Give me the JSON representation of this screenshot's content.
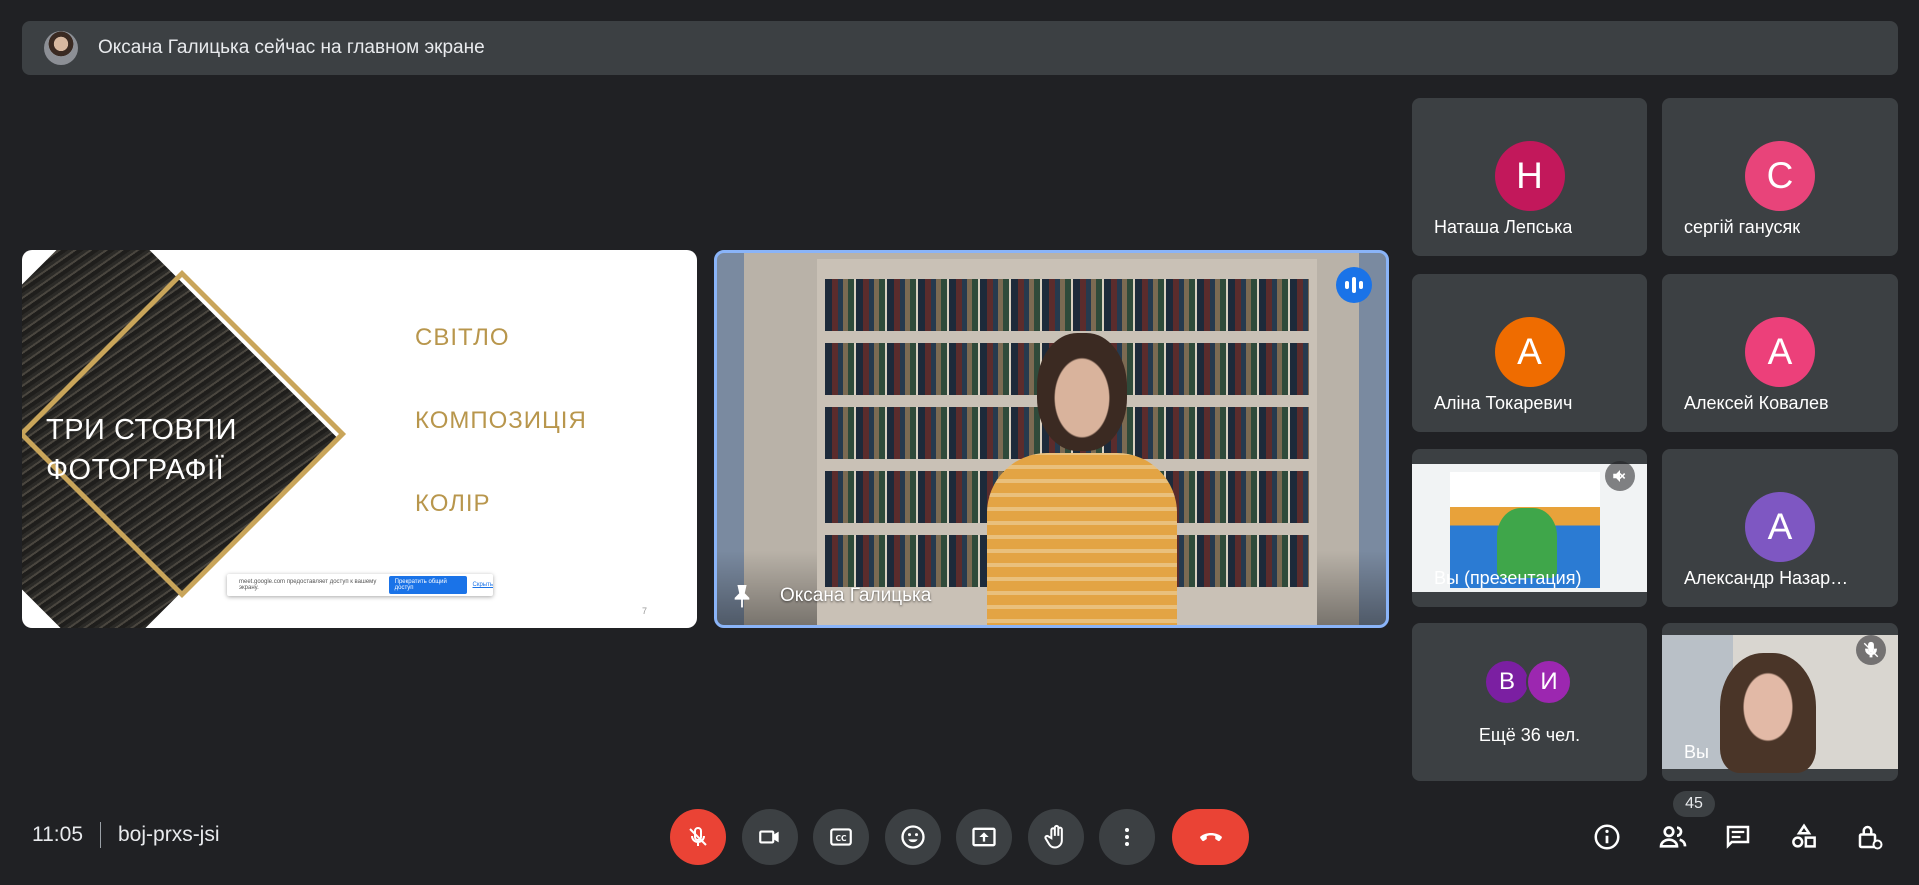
{
  "banner": {
    "text": "Оксана Галицька сейчас на главном экране"
  },
  "slide": {
    "title": "ТРИ СТОВПИ ФОТОГРАФІЇ",
    "items": [
      "СВІТЛО",
      "КОМПОЗИЦІЯ",
      "КОЛІР"
    ],
    "share_notice": "meet.google.com предоставляет доступ к вашему экрану.",
    "share_stop": "Прекратить общий доступ",
    "share_hide": "Скрыть",
    "page_number": "7"
  },
  "main_video": {
    "name": "Оксана Галицька"
  },
  "participants": [
    {
      "initial": "Н",
      "name": "Наташа Лепська",
      "color": "#c2185b"
    },
    {
      "initial": "С",
      "name": "сергій ганусяк",
      "color": "#e8447a"
    },
    {
      "initial": "А",
      "name": "Аліна Токаревич",
      "color": "#ef6c00"
    },
    {
      "initial": "А",
      "name": "Алексей Ковалев",
      "color": "#ec407a"
    },
    {
      "initial": "",
      "name": "Вы (презентация)",
      "color": ""
    },
    {
      "initial": "А",
      "name": "Александр Назар…",
      "color": "#7e57c2"
    }
  ],
  "more": {
    "initials": [
      "В",
      "И"
    ],
    "colors": [
      "#7b1fa2",
      "#9c27b0"
    ],
    "text": "Ещё 36 чел."
  },
  "self_tile": {
    "name": "Вы"
  },
  "bottom": {
    "time": "11:05",
    "meeting_code": "boj-prxs-jsi",
    "participant_count": "45"
  },
  "icons": {
    "controls": [
      "mic-off-icon",
      "camera-icon",
      "captions-icon",
      "emoji-icon",
      "present-icon",
      "hand-icon",
      "more-icon",
      "end-call-icon"
    ],
    "right": [
      "info-icon",
      "people-icon",
      "chat-icon",
      "activities-icon",
      "host-controls-icon"
    ]
  },
  "colors": {
    "background": "#202124",
    "tile": "#3c4043",
    "accent": "#1a73e8",
    "danger": "#ea4335",
    "highlight_border": "#8ab4f8"
  }
}
